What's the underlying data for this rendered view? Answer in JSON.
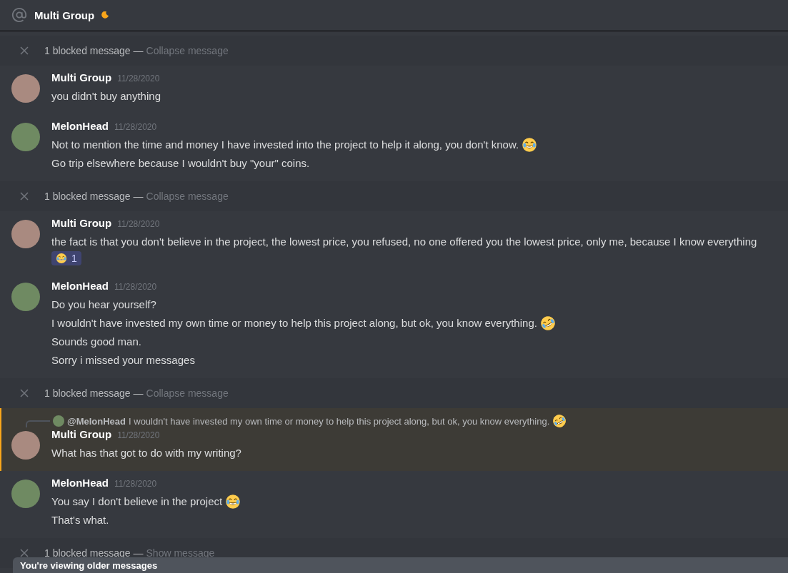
{
  "header": {
    "title": "Multi Group",
    "idle": true
  },
  "items": [
    {
      "kind": "blocked",
      "label": "1 blocked message —",
      "action": "Collapse message"
    },
    {
      "kind": "message",
      "avatar": {
        "kind": "portrait"
      },
      "author": "Multi Group",
      "timestamp": "11/28/2020",
      "highlighted": false,
      "lines": [
        {
          "text": "you didn't buy anything"
        }
      ]
    },
    {
      "kind": "message",
      "avatar": {
        "kind": "landscape"
      },
      "author": "MelonHead",
      "timestamp": "11/28/2020",
      "highlighted": false,
      "lines": [
        {
          "text": "Not to mention the time and money I have invested into the project to help it along, you don't know.",
          "emoji": {
            "kind": "joy"
          }
        },
        {
          "text": "Go trip elsewhere because I wouldn't buy \"your\" coins."
        }
      ]
    },
    {
      "kind": "blocked",
      "label": "1 blocked message —",
      "action": "Collapse message"
    },
    {
      "kind": "message",
      "avatar": {
        "kind": "portrait"
      },
      "author": "Multi Group",
      "timestamp": "11/28/2020",
      "highlighted": false,
      "lines": [
        {
          "text": "the fact is that you don't believe in the project, the lowest price, you refused, no one offered you the lowest price, only me, because I know everything"
        }
      ],
      "reaction": {
        "emoji": {
          "kind": "joy"
        },
        "count": "1"
      }
    },
    {
      "kind": "message",
      "avatar": {
        "kind": "landscape"
      },
      "author": "MelonHead",
      "timestamp": "11/28/2020",
      "highlighted": false,
      "lines": [
        {
          "text": "Do you hear yourself?"
        },
        {
          "text": "I wouldn't have invested my own time or money to help this project along, but ok, you know everything.",
          "emoji": {
            "kind": "rofl"
          }
        },
        {
          "text": "Sounds good man."
        },
        {
          "text": "Sorry i missed your messages"
        }
      ]
    },
    {
      "kind": "blocked",
      "label": "1 blocked message —",
      "action": "Collapse message"
    },
    {
      "kind": "message",
      "avatar": {
        "kind": "portrait"
      },
      "author": "Multi Group",
      "timestamp": "11/28/2020",
      "highlighted": true,
      "reply": {
        "avatar": {
          "kind": "landscape"
        },
        "author": "@MelonHead",
        "text": "I wouldn't have invested my own time or money to help this project along, but ok, you know everything.",
        "emoji": {
          "kind": "rofl"
        }
      },
      "lines": [
        {
          "text": "What has that got to do with my writing?"
        }
      ]
    },
    {
      "kind": "message",
      "avatar": {
        "kind": "landscape"
      },
      "author": "MelonHead",
      "timestamp": "11/28/2020",
      "highlighted": false,
      "lines": [
        {
          "text": "You say I don't believe in the project",
          "emoji": {
            "kind": "joy"
          }
        },
        {
          "text": "That's what."
        }
      ]
    },
    {
      "kind": "blocked",
      "label": "1 blocked message —",
      "action": "Show message"
    }
  ],
  "banner": "You're viewing older messages"
}
